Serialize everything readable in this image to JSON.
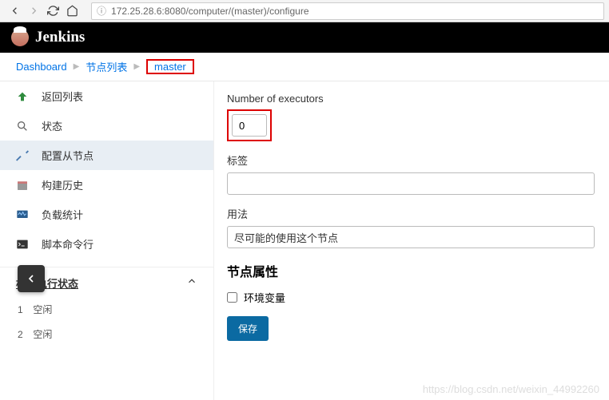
{
  "url": "172.25.28.6:8080/computer/(master)/configure",
  "brand": "Jenkins",
  "crumbs": {
    "dashboard": "Dashboard",
    "nodes": "节点列表",
    "master": "master"
  },
  "sidebar": {
    "items": [
      {
        "label": "返回列表"
      },
      {
        "label": "状态"
      },
      {
        "label": "配置从节点"
      },
      {
        "label": "构建历史"
      },
      {
        "label": "负载统计"
      },
      {
        "label": "脚本命令行"
      }
    ],
    "section_title": "构建执行状态",
    "rows": [
      {
        "n": "1",
        "label": "空闲"
      },
      {
        "n": "2",
        "label": "空闲"
      }
    ]
  },
  "form": {
    "executors_label": "Number of executors",
    "executors_value": "0",
    "labels_label": "标签",
    "labels_value": "",
    "usage_label": "用法",
    "usage_value": "尽可能的使用这个节点",
    "section": "节点属性",
    "env_label": "环境变量",
    "save_label": "保存"
  },
  "watermark": "https://blog.csdn.net/weixin_44992260"
}
